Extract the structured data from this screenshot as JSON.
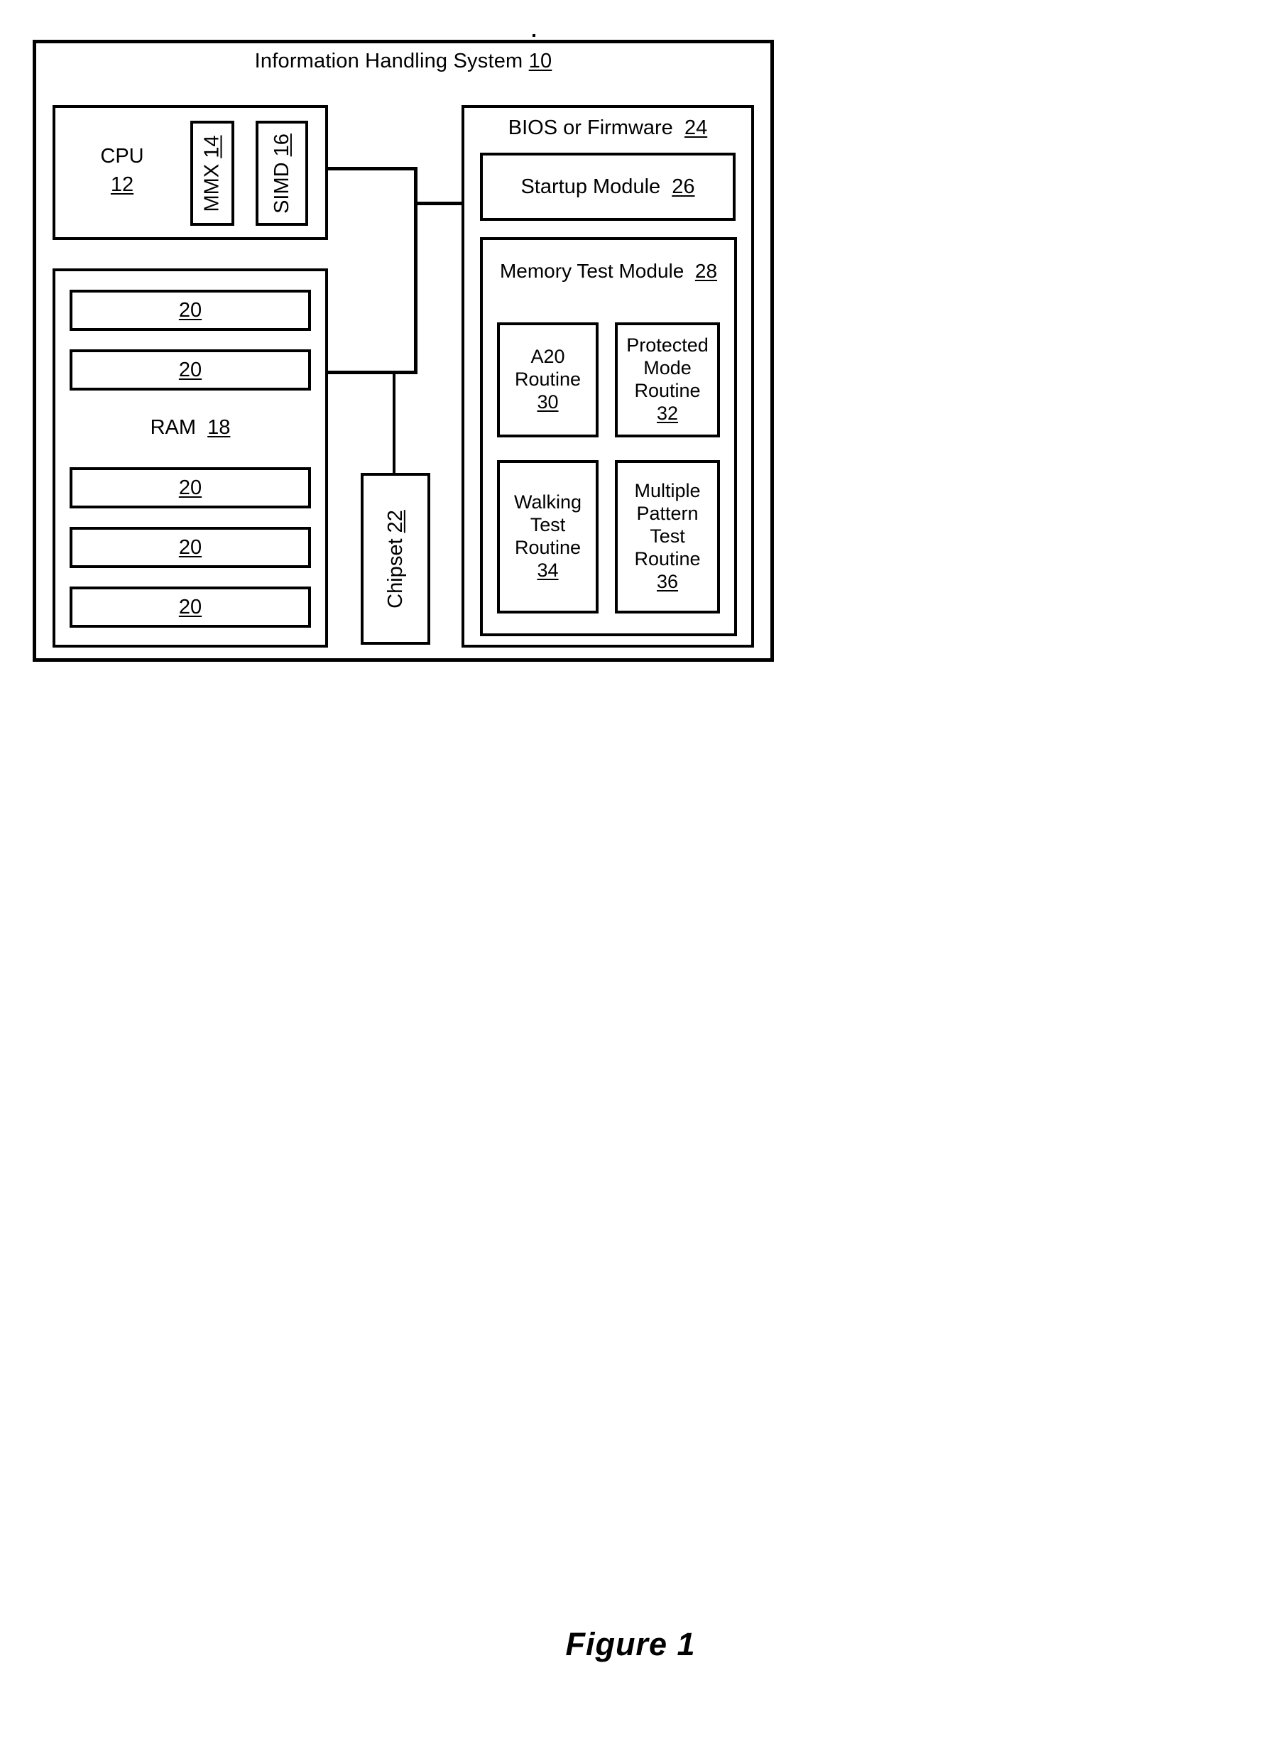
{
  "figure": {
    "caption": "Figure 1"
  },
  "system": {
    "title_text": "Information Handling System",
    "title_ref": "10"
  },
  "cpu": {
    "label": "CPU",
    "ref": "12",
    "units": [
      {
        "label": "MMX",
        "ref": "14"
      },
      {
        "label": "SIMD",
        "ref": "16"
      }
    ]
  },
  "ram": {
    "label": "RAM",
    "ref": "18",
    "slots": [
      {
        "ref": "20"
      },
      {
        "ref": "20"
      },
      {
        "ref": "20"
      },
      {
        "ref": "20"
      },
      {
        "ref": "20"
      }
    ]
  },
  "chipset": {
    "label": "Chipset",
    "ref": "22"
  },
  "bios": {
    "title_text": "BIOS or Firmware",
    "title_ref": "24",
    "startup_module": {
      "label": "Startup Module",
      "ref": "26"
    },
    "memory_test_module": {
      "title_text": "Memory Test Module",
      "title_ref": "28",
      "routines": [
        {
          "line1": "A20",
          "line2": "Routine",
          "line3": "",
          "line4": "",
          "ref": "30"
        },
        {
          "line1": "Protected",
          "line2": "Mode",
          "line3": "Routine",
          "line4": "",
          "ref": "32"
        },
        {
          "line1": "Walking",
          "line2": "Test",
          "line3": "Routine",
          "line4": "",
          "ref": "34"
        },
        {
          "line1": "Multiple",
          "line2": "Pattern",
          "line3": "Test",
          "line4": "Routine",
          "ref": "36"
        }
      ]
    }
  },
  "colors": {
    "ink": "#000000",
    "paper": "#ffffff"
  }
}
